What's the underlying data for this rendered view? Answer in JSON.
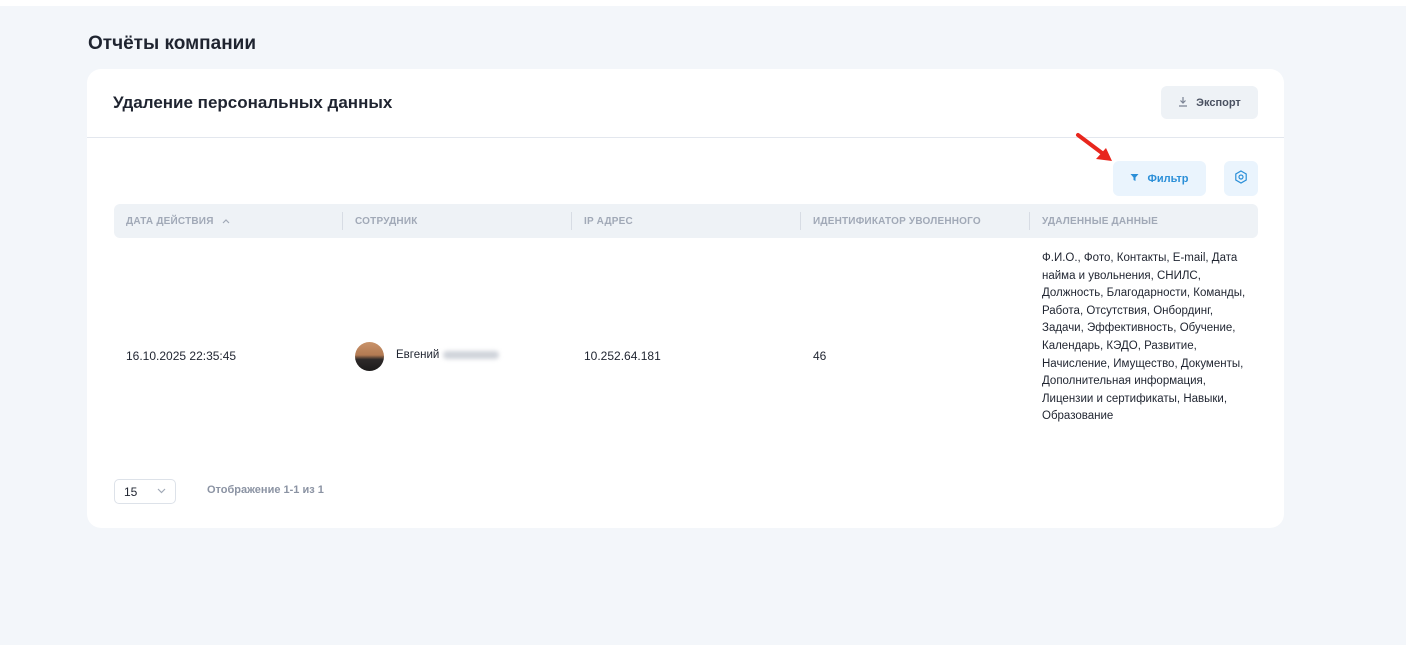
{
  "page": {
    "title": "Отчёты компании"
  },
  "card": {
    "title": "Удаление персональных данных",
    "export_label": "Экспорт",
    "export_icon": "download-icon"
  },
  "toolbar": {
    "filter_label": "Фильтр",
    "filter_icon": "funnel-icon",
    "settings_icon": "settings-icon"
  },
  "table": {
    "columns": [
      "Дата действия",
      "Сотрудник",
      "IP адрес",
      "Идентификатор уволенного",
      "Удаленные данные"
    ],
    "sort_column": "Дата действия",
    "sort_direction": "asc",
    "rows": [
      {
        "date": "16.10.2025 22:35:45",
        "employee_first_name": "Евгений",
        "ip": "10.252.64.181",
        "dismissed_id": "46",
        "deleted_data": "Ф.И.О., Фото, Контакты, E-mail, Дата найма и увольнения, СНИЛС, Должность, Благодарности, Команды, Работа, Отсутствия, Онбординг, Задачи, Эффективность, Обучение, Календарь, КЭДО, Развитие, Начисление, Имущество, Документы, Дополнительная информация, Лицензии и сертификаты, Навыки, Образование"
      }
    ]
  },
  "pagination": {
    "page_size": "15",
    "info": "Отображение 1-1 из 1"
  },
  "colors": {
    "accent": "#2b8fd8",
    "annotation_arrow": "#e8261d"
  }
}
